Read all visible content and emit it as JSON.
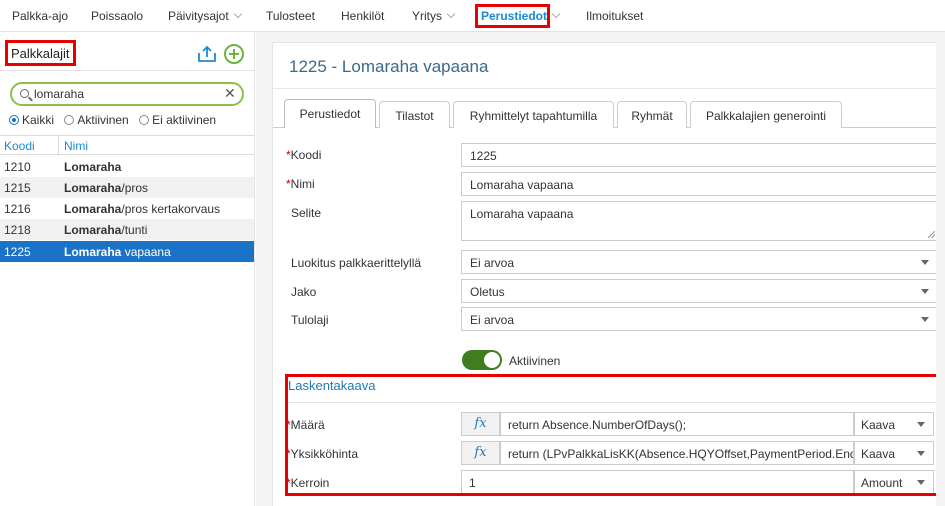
{
  "topnav": {
    "items": [
      {
        "label": "Palkka-ajo",
        "dropdown": false
      },
      {
        "label": "Poissaolo",
        "dropdown": false
      },
      {
        "label": "Päivitysajot",
        "dropdown": true
      },
      {
        "label": "Tulosteet",
        "dropdown": false
      },
      {
        "label": "Henkilöt",
        "dropdown": false
      },
      {
        "label": "Yritys",
        "dropdown": true
      },
      {
        "label": "Perustiedot",
        "dropdown": true,
        "active": true
      },
      {
        "label": "Ilmoitukset",
        "dropdown": false
      }
    ]
  },
  "left": {
    "title": "Palkkalajit",
    "search": {
      "value": "lomaraha",
      "clear_glyph": "✕"
    },
    "filters": [
      {
        "label": "Kaikki",
        "selected": true
      },
      {
        "label": "Aktiivinen",
        "selected": false
      },
      {
        "label": "Ei aktiivinen",
        "selected": false
      }
    ],
    "columns": {
      "code": "Koodi",
      "name": "Nimi"
    },
    "rows": [
      {
        "code": "1210",
        "bold": "Lomaraha",
        "rest": ""
      },
      {
        "code": "1215",
        "bold": "Lomaraha",
        "rest": "/pros"
      },
      {
        "code": "1216",
        "bold": "Lomaraha",
        "rest": "/pros kertakorvaus"
      },
      {
        "code": "1218",
        "bold": "Lomaraha",
        "rest": "/tunti"
      },
      {
        "code": "1225",
        "bold": "Lomaraha",
        "rest": " vapaana",
        "selected": true
      }
    ]
  },
  "detail": {
    "title": "1225 - Lomaraha vapaana",
    "tabs": [
      "Perustiedot",
      "Tilastot",
      "Ryhmittelyt tapahtumilla",
      "Ryhmät",
      "Palkkalajien generointi"
    ],
    "fields": {
      "koodi": {
        "label": "Koodi",
        "value": "1225"
      },
      "nimi": {
        "label": "Nimi",
        "value": "Lomaraha vapaana"
      },
      "selite": {
        "label": "Selite",
        "value": "Lomaraha vapaana"
      },
      "luokitus": {
        "label": "Luokitus palkkaerittelyllä",
        "value": "Ei arvoa"
      },
      "jako": {
        "label": "Jako",
        "value": "Oletus"
      },
      "tulolaji": {
        "label": "Tulolaji",
        "value": "Ei arvoa"
      }
    },
    "required_mark": "*",
    "active_toggle": {
      "label": "Aktiivinen",
      "on": true
    },
    "laskenta": {
      "title": "Laskentakaava",
      "fx_label": "fx",
      "maara": {
        "label": "Määrä",
        "formula": "return Absence.NumberOfDays();",
        "mode": "Kaava"
      },
      "yksikkohinta": {
        "label": "Yksikköhinta",
        "formula": "return (LPvPalkkaLisKK(Absence.HQYOffset,PaymentPeriod.EndD",
        "mode": "Kaava"
      },
      "kerroin": {
        "label": "Kerroin",
        "value": "1",
        "mode": "Amount"
      }
    }
  },
  "colors": {
    "accent": "#1a73c7",
    "highlight": "#e60000",
    "toggle": "#3f7d1e",
    "add": "#6db33f"
  }
}
